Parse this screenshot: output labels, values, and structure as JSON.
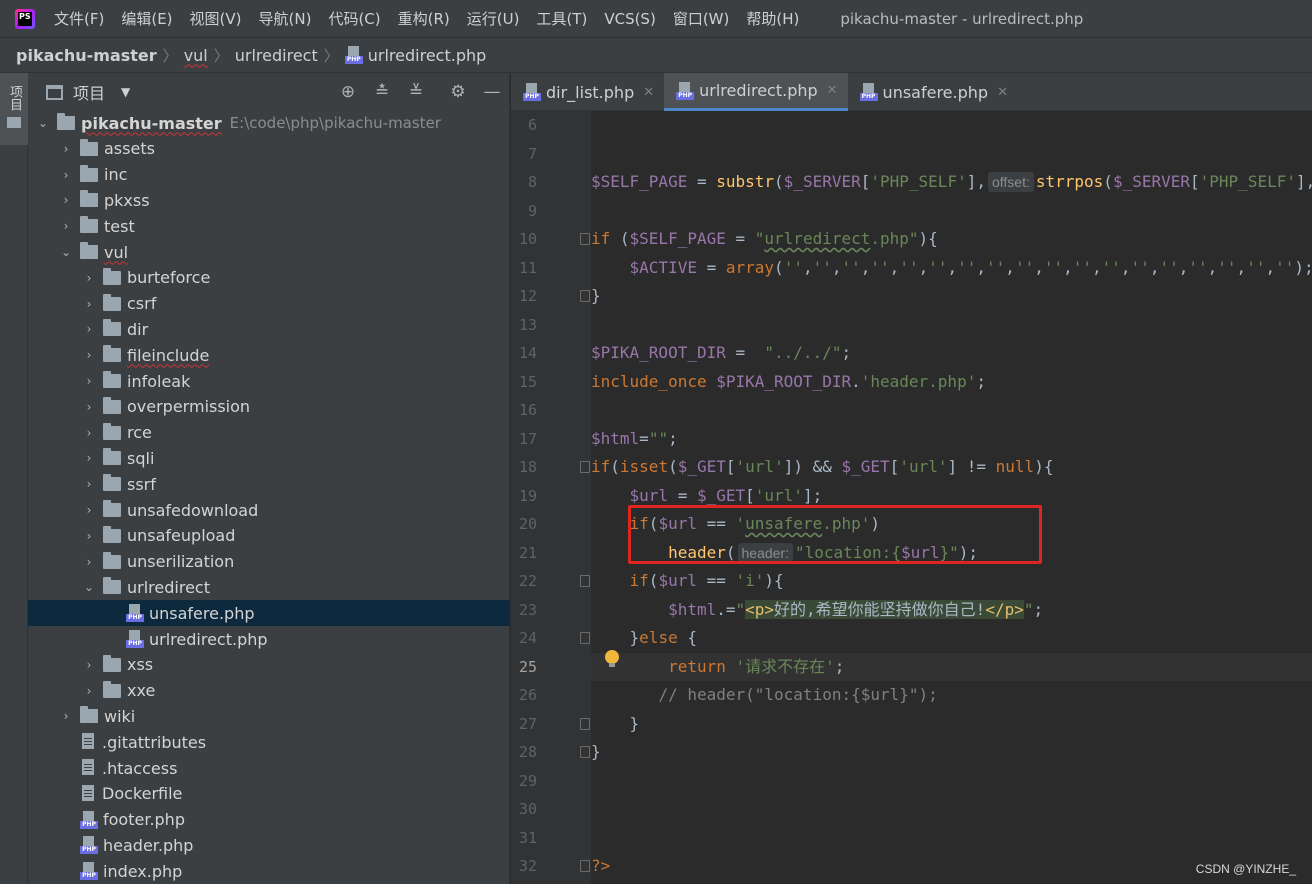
{
  "menubar": {
    "app_icon": "phpstorm-logo",
    "items": [
      "文件(F)",
      "编辑(E)",
      "视图(V)",
      "导航(N)",
      "代码(C)",
      "重构(R)",
      "运行(U)",
      "工具(T)",
      "VCS(S)",
      "窗口(W)",
      "帮助(H)"
    ],
    "window_title": "pikachu-master - urlredirect.php"
  },
  "breadcrumb": {
    "items": [
      "pikachu-master",
      "vul",
      "urlredirect",
      "urlredirect.php"
    ]
  },
  "left_strip": {
    "label": "项目"
  },
  "project": {
    "header_label": "项目",
    "root_name": "pikachu-master",
    "root_path": "E:\\code\\php\\pikachu-master",
    "top_folders": [
      "assets",
      "inc",
      "pkxss",
      "test",
      "vul"
    ],
    "vul_folders": [
      "burteforce",
      "csrf",
      "dir",
      "fileinclude",
      "infoleak",
      "overpermission",
      "rce",
      "sqli",
      "ssrf",
      "unsafedownload",
      "unsafeupload",
      "unserilization",
      "urlredirect"
    ],
    "urlredirect_files": [
      "unsafere.php",
      "urlredirect.php"
    ],
    "after_folders": [
      "xss",
      "xxe"
    ],
    "wiki": "wiki",
    "root_files": [
      ".gitattributes",
      ".htaccess",
      "Dockerfile",
      "footer.php",
      "header.php",
      "index.php"
    ]
  },
  "tabs": [
    {
      "label": "dir_list.php"
    },
    {
      "label": "urlredirect.php"
    },
    {
      "label": "unsafere.php"
    }
  ],
  "editor": {
    "line_numbers": [
      "6",
      "7",
      "8",
      "9",
      "10",
      "11",
      "12",
      "13",
      "14",
      "15",
      "16",
      "17",
      "18",
      "19",
      "20",
      "21",
      "22",
      "23",
      "24",
      "25",
      "26",
      "27",
      "28",
      "29",
      "30",
      "31",
      "32"
    ],
    "current_line": "25",
    "hint_offset": "offset:",
    "hint_header": "header:"
  },
  "watermark": "CSDN @YINZHE_"
}
